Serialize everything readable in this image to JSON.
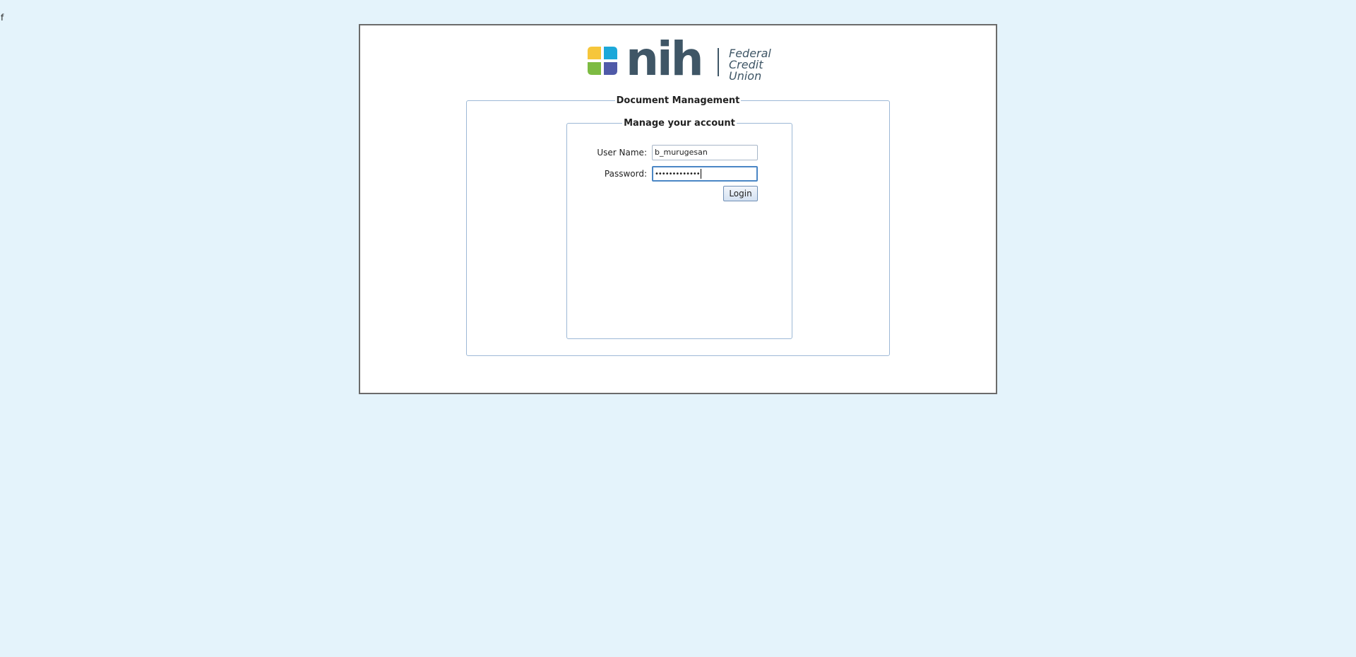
{
  "stray_text": "f",
  "logo": {
    "wordmark": "nih",
    "tagline_lines": [
      "Federal",
      "Credit",
      "Union"
    ],
    "colors": {
      "yellow": "#f6c63a",
      "cyan": "#1ca8d9",
      "green": "#7dbb42",
      "purple": "#4f5aa8",
      "wordmark": "#3f5666"
    }
  },
  "outer_fieldset": {
    "legend": "Document Management"
  },
  "inner_fieldset": {
    "legend": "Manage your account"
  },
  "form": {
    "username_label": "User Name:",
    "username_value": "b_murugesan",
    "password_label": "Password:",
    "password_mask": "•••••••••••••",
    "login_label": "Login"
  },
  "colors": {
    "page_background": "#e4f3fb",
    "fieldset_border": "#9db8d6",
    "focus_border": "#4a86c5"
  }
}
